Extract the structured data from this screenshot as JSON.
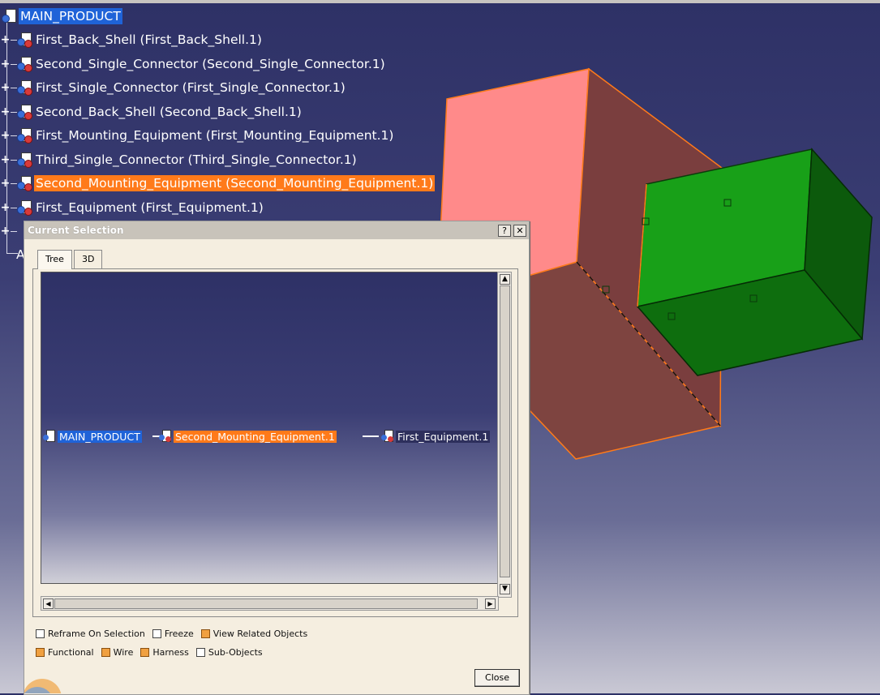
{
  "tree": {
    "root": "MAIN_PRODUCT",
    "items": [
      {
        "label": "First_Back_Shell (First_Back_Shell.1)",
        "selected": false
      },
      {
        "label": "Second_Single_Connector (Second_Single_Connector.1)",
        "selected": false
      },
      {
        "label": "First_Single_Connector (First_Single_Connector.1)",
        "selected": false
      },
      {
        "label": "Second_Back_Shell (Second_Back_Shell.1)",
        "selected": false
      },
      {
        "label": "First_Mounting_Equipment (First_Mounting_Equipment.1)",
        "selected": false
      },
      {
        "label": "Third_Single_Connector (Third_Single_Connector.1)",
        "selected": false
      },
      {
        "label": "Second_Mounting_Equipment (Second_Mounting_Equipment.1)",
        "selected": true
      },
      {
        "label": "First_Equipment (First_Equipment.1)",
        "selected": false
      }
    ],
    "partial_label": "A"
  },
  "dialog": {
    "title": "Current Selection",
    "help_button": "?",
    "close_x": "✕",
    "tabs": [
      {
        "label": "Tree",
        "active": true
      },
      {
        "label": "3D",
        "active": false
      }
    ],
    "path": {
      "root": "MAIN_PRODUCT",
      "selected": "Second_Mounting_Equipment.1",
      "child": "First_Equipment.1"
    },
    "options_row1": [
      {
        "label": "Reframe On Selection",
        "checked": false
      },
      {
        "label": "Freeze",
        "checked": false
      },
      {
        "label": "View Related Objects",
        "checked": true
      }
    ],
    "options_row2": [
      {
        "label": "Functional",
        "checked": true
      },
      {
        "label": "Wire",
        "checked": true
      },
      {
        "label": "Harness",
        "checked": true
      },
      {
        "label": "Sub-Objects",
        "checked": false
      }
    ],
    "close_label": "Close"
  },
  "colors": {
    "selection_orange": "#ff7a1a",
    "root_blue": "#1f63d8",
    "box_pink": "#ff8a8a",
    "box_shaded": "#7a3e3e",
    "box_green": "#1a9a1a",
    "edge_orange": "#ff7a1a"
  }
}
